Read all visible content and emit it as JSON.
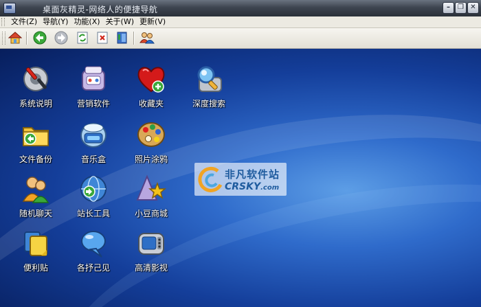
{
  "window": {
    "title": "桌面灰精灵-网络人的便捷导航",
    "buttons": {
      "minimize": "–",
      "restore": "❐",
      "close": "✕"
    }
  },
  "menu": [
    {
      "label": "文件(Z)"
    },
    {
      "label": "导航(Y)"
    },
    {
      "label": "功能(X)"
    },
    {
      "label": "关于(W)"
    },
    {
      "label": "更新(V)"
    }
  ],
  "toolbar": {
    "icons": [
      "home-icon",
      "back-icon",
      "forward-icon",
      "refresh-icon",
      "delete-icon",
      "book-icon",
      "users-icon"
    ]
  },
  "apps": [
    {
      "label": "系统说明",
      "icon": "wrench-icon"
    },
    {
      "label": "营销软件",
      "icon": "market-icon"
    },
    {
      "label": "收藏夹",
      "icon": "heart-icon"
    },
    {
      "label": "深度搜索",
      "icon": "search-icon"
    },
    {
      "label": "文件备份",
      "icon": "folder-icon"
    },
    {
      "label": "音乐盒",
      "icon": "music-icon"
    },
    {
      "label": "照片涂鸦",
      "icon": "palette-icon"
    },
    {
      "label": "随机聊天",
      "icon": "chat-people-icon"
    },
    {
      "label": "站长工具",
      "icon": "globe-icon"
    },
    {
      "label": "小豆商城",
      "icon": "star-cone-icon"
    },
    {
      "label": "便利贴",
      "icon": "note-icon"
    },
    {
      "label": "各抒己见",
      "icon": "bubble-icon"
    },
    {
      "label": "高清影视",
      "icon": "tv-icon"
    }
  ],
  "watermark": {
    "cn": "非凡软件站",
    "en": "CRSKY",
    "domain": ".com"
  },
  "colors": {
    "titlebar": "#3e4550",
    "menubar": "#eceae2",
    "desktop": "#2f6bcb",
    "label_text": "#ffffff"
  }
}
